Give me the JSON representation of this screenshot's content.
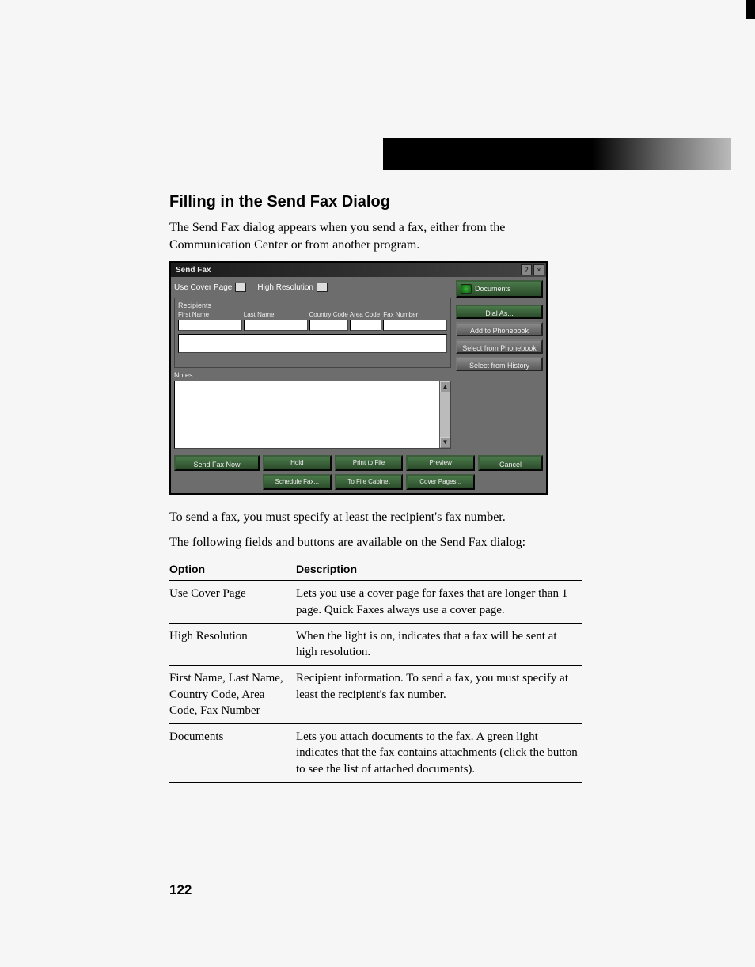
{
  "section_title": "Filling in the Send Fax Dialog",
  "intro_text": "The Send Fax dialog appears when you send a fax, either from the Communication Center or from another program.",
  "dialog": {
    "title": "Send Fax",
    "help_btn": "?",
    "close_btn": "×",
    "use_cover_label": "Use Cover Page",
    "high_res_label": "High Resolution",
    "recipients_label": "Recipients",
    "first_name_label": "First Name",
    "last_name_label": "Last Name",
    "country_code_label": "Country Code",
    "area_code_label": "Area Code",
    "fax_number_label": "Fax Number",
    "notes_label": "Notes",
    "documents_btn": "Documents",
    "dial_btn": "Dial As...",
    "add_phonebook_btn": "Add to Phonebook",
    "select_phonebook_btn": "Select from Phonebook",
    "select_history_btn": "Select from History",
    "send_now_btn": "Send Fax Now",
    "hold_btn": "Hold",
    "schedule_btn": "Schedule Fax...",
    "print_btn": "Print to File",
    "filecab_btn": "To File Cabinet",
    "preview_btn": "Preview",
    "coverpages_btn": "Cover Pages...",
    "cancel_btn": "Cancel"
  },
  "after_dialog_1": "To send a fax, you must specify at least the recipient's fax number.",
  "after_dialog_2": "The following fields and buttons are available on the Send Fax dialog:",
  "table": {
    "head_option": "Option",
    "head_description": "Description",
    "rows": [
      {
        "option": "Use Cover Page",
        "description": "Lets you use a cover page for faxes that are longer than 1 page. Quick Faxes always use a cover page."
      },
      {
        "option": "High Resolution",
        "description": "When the light is on, indicates that a fax will be sent at high resolution."
      },
      {
        "option": "First Name, Last Name, Country Code, Area Code, Fax Number",
        "description": "Recipient information. To send a fax, you must specify at least the recipient's fax number."
      },
      {
        "option": "Documents",
        "description": "Lets you attach documents to the fax. A green light indicates that the fax contains attachments (click the button to see the list of attached documents)."
      }
    ]
  },
  "page_number": "122"
}
